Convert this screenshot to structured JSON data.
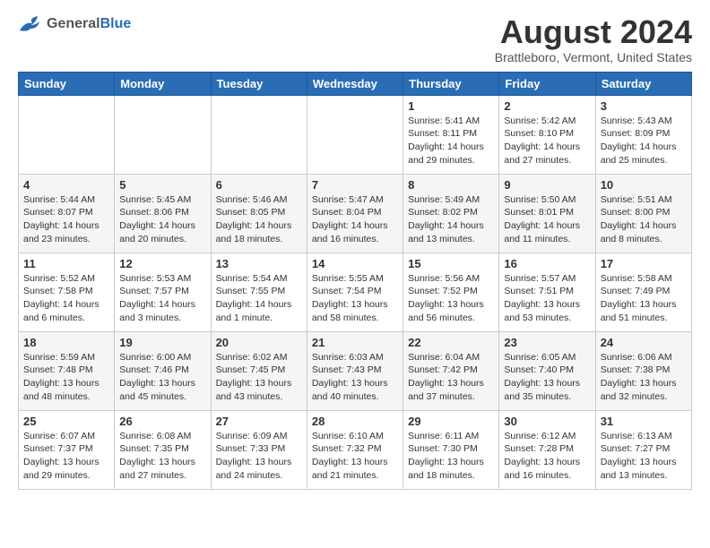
{
  "logo": {
    "general": "General",
    "blue": "Blue"
  },
  "title": "August 2024",
  "subtitle": "Brattleboro, Vermont, United States",
  "days": [
    "Sunday",
    "Monday",
    "Tuesday",
    "Wednesday",
    "Thursday",
    "Friday",
    "Saturday"
  ],
  "weeks": [
    [
      {
        "day": "",
        "content": ""
      },
      {
        "day": "",
        "content": ""
      },
      {
        "day": "",
        "content": ""
      },
      {
        "day": "",
        "content": ""
      },
      {
        "day": "1",
        "content": "Sunrise: 5:41 AM\nSunset: 8:11 PM\nDaylight: 14 hours\nand 29 minutes."
      },
      {
        "day": "2",
        "content": "Sunrise: 5:42 AM\nSunset: 8:10 PM\nDaylight: 14 hours\nand 27 minutes."
      },
      {
        "day": "3",
        "content": "Sunrise: 5:43 AM\nSunset: 8:09 PM\nDaylight: 14 hours\nand 25 minutes."
      }
    ],
    [
      {
        "day": "4",
        "content": "Sunrise: 5:44 AM\nSunset: 8:07 PM\nDaylight: 14 hours\nand 23 minutes."
      },
      {
        "day": "5",
        "content": "Sunrise: 5:45 AM\nSunset: 8:06 PM\nDaylight: 14 hours\nand 20 minutes."
      },
      {
        "day": "6",
        "content": "Sunrise: 5:46 AM\nSunset: 8:05 PM\nDaylight: 14 hours\nand 18 minutes."
      },
      {
        "day": "7",
        "content": "Sunrise: 5:47 AM\nSunset: 8:04 PM\nDaylight: 14 hours\nand 16 minutes."
      },
      {
        "day": "8",
        "content": "Sunrise: 5:49 AM\nSunset: 8:02 PM\nDaylight: 14 hours\nand 13 minutes."
      },
      {
        "day": "9",
        "content": "Sunrise: 5:50 AM\nSunset: 8:01 PM\nDaylight: 14 hours\nand 11 minutes."
      },
      {
        "day": "10",
        "content": "Sunrise: 5:51 AM\nSunset: 8:00 PM\nDaylight: 14 hours\nand 8 minutes."
      }
    ],
    [
      {
        "day": "11",
        "content": "Sunrise: 5:52 AM\nSunset: 7:58 PM\nDaylight: 14 hours\nand 6 minutes."
      },
      {
        "day": "12",
        "content": "Sunrise: 5:53 AM\nSunset: 7:57 PM\nDaylight: 14 hours\nand 3 minutes."
      },
      {
        "day": "13",
        "content": "Sunrise: 5:54 AM\nSunset: 7:55 PM\nDaylight: 14 hours\nand 1 minute."
      },
      {
        "day": "14",
        "content": "Sunrise: 5:55 AM\nSunset: 7:54 PM\nDaylight: 13 hours\nand 58 minutes."
      },
      {
        "day": "15",
        "content": "Sunrise: 5:56 AM\nSunset: 7:52 PM\nDaylight: 13 hours\nand 56 minutes."
      },
      {
        "day": "16",
        "content": "Sunrise: 5:57 AM\nSunset: 7:51 PM\nDaylight: 13 hours\nand 53 minutes."
      },
      {
        "day": "17",
        "content": "Sunrise: 5:58 AM\nSunset: 7:49 PM\nDaylight: 13 hours\nand 51 minutes."
      }
    ],
    [
      {
        "day": "18",
        "content": "Sunrise: 5:59 AM\nSunset: 7:48 PM\nDaylight: 13 hours\nand 48 minutes."
      },
      {
        "day": "19",
        "content": "Sunrise: 6:00 AM\nSunset: 7:46 PM\nDaylight: 13 hours\nand 45 minutes."
      },
      {
        "day": "20",
        "content": "Sunrise: 6:02 AM\nSunset: 7:45 PM\nDaylight: 13 hours\nand 43 minutes."
      },
      {
        "day": "21",
        "content": "Sunrise: 6:03 AM\nSunset: 7:43 PM\nDaylight: 13 hours\nand 40 minutes."
      },
      {
        "day": "22",
        "content": "Sunrise: 6:04 AM\nSunset: 7:42 PM\nDaylight: 13 hours\nand 37 minutes."
      },
      {
        "day": "23",
        "content": "Sunrise: 6:05 AM\nSunset: 7:40 PM\nDaylight: 13 hours\nand 35 minutes."
      },
      {
        "day": "24",
        "content": "Sunrise: 6:06 AM\nSunset: 7:38 PM\nDaylight: 13 hours\nand 32 minutes."
      }
    ],
    [
      {
        "day": "25",
        "content": "Sunrise: 6:07 AM\nSunset: 7:37 PM\nDaylight: 13 hours\nand 29 minutes."
      },
      {
        "day": "26",
        "content": "Sunrise: 6:08 AM\nSunset: 7:35 PM\nDaylight: 13 hours\nand 27 minutes."
      },
      {
        "day": "27",
        "content": "Sunrise: 6:09 AM\nSunset: 7:33 PM\nDaylight: 13 hours\nand 24 minutes."
      },
      {
        "day": "28",
        "content": "Sunrise: 6:10 AM\nSunset: 7:32 PM\nDaylight: 13 hours\nand 21 minutes."
      },
      {
        "day": "29",
        "content": "Sunrise: 6:11 AM\nSunset: 7:30 PM\nDaylight: 13 hours\nand 18 minutes."
      },
      {
        "day": "30",
        "content": "Sunrise: 6:12 AM\nSunset: 7:28 PM\nDaylight: 13 hours\nand 16 minutes."
      },
      {
        "day": "31",
        "content": "Sunrise: 6:13 AM\nSunset: 7:27 PM\nDaylight: 13 hours\nand 13 minutes."
      }
    ]
  ]
}
